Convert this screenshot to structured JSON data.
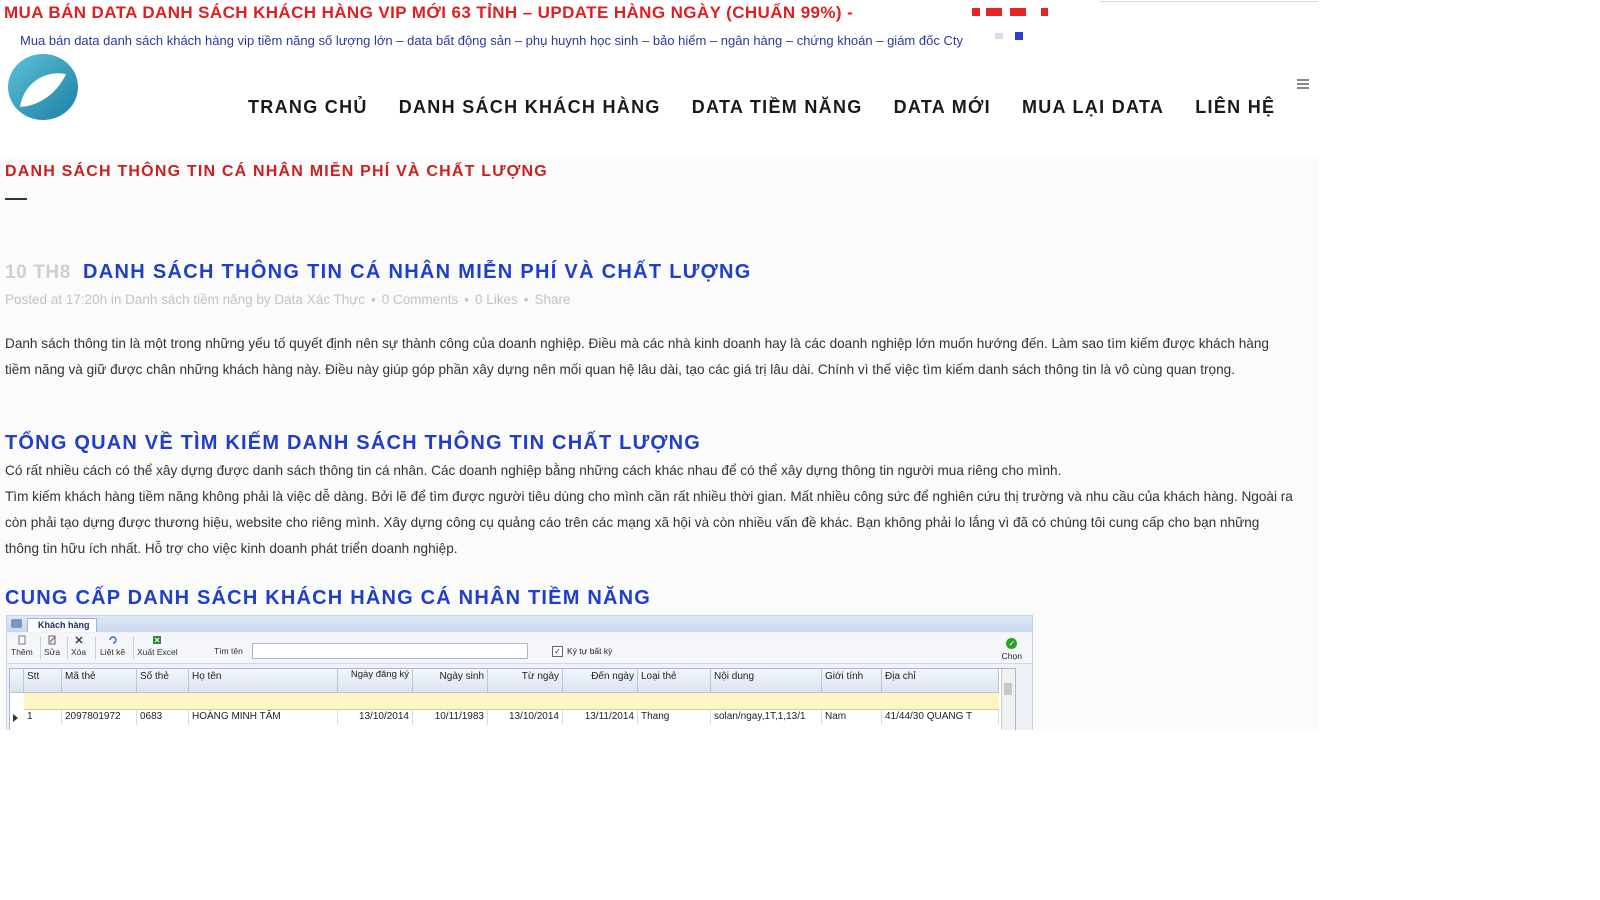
{
  "top_banner": {
    "title": "MUA BÁN DATA DANH SÁCH KHÁCH HÀNG VIP MỚI 63 TỈNH – UPDATE HÀNG NGÀY (CHUẨN 99%) -",
    "tagline": "Mua bán data danh sách khách hàng vip tiềm năng số lượng lớn – data bất động sản – phụ huynh học sinh – bảo hiểm – ngân hàng – chứng khoán – giám đốc Cty",
    "accent_color": "#e02020"
  },
  "header": {
    "logo_icon": "circle-swirl-logo",
    "nav": [
      "TRANG CHỦ",
      "DANH SÁCH KHÁCH HÀNG",
      "DATA TIỀM NĂNG",
      "DATA MỚI",
      "MUA LẠI DATA",
      "LIÊN HỆ"
    ],
    "menu_icon": "hamburger-icon"
  },
  "page_title": "DANH SÁCH THÔNG TIN CÁ NHÂN MIỄN PHÍ VÀ CHẤT LƯỢNG",
  "post": {
    "date": "10 TH8",
    "title": "DANH SÁCH THÔNG TIN CÁ NHÂN MIỄN PHÍ VÀ CHẤT LƯỢNG",
    "meta": {
      "posted": "Posted at 17:20h in Danh sách tiềm năng by Data Xác Thực",
      "comments": "0 Comments",
      "likes": "0 Likes",
      "share": "Share"
    },
    "intro": "Danh sách thông tin là một trong những yếu tố quyết định nên sự thành công của doanh nghiệp. Điều mà các nhà kinh doanh hay là các doanh nghiệp lớn muốn hướng đến. Làm sao tìm kiếm được khách hàng tiềm năng và giữ được chân những khách hàng này. Điều này giúp góp phần xây dựng nên mối quan hệ lâu dài, tạo các giá trị lâu dài. Chính vì thế việc tìm kiếm danh sách thông tin là vô cùng quan trọng.",
    "heading1": "TỔNG QUAN VỀ TÌM KIẾM DANH SÁCH THÔNG TIN CHẤT LƯỢNG",
    "section1_lines": [
      "Có rất nhiều cách có thể xây dựng được danh sách thông tin cá nhân. Các doanh nghiệp bằng những cách khác nhau để có thể xây dựng thông tin người mua riêng cho mình.",
      "Tìm kiếm khách hàng tiềm năng không phải là việc dễ dàng. Bởi lẽ để tìm được người tiêu dùng cho mình cần rất nhiều thời gian. Mất nhiều công sức để nghiên cứu thị trường và nhu cầu của khách hàng. Ngoài ra còn phải tạo dựng được thương hiệu, website cho riêng mình. Xây dựng công cụ quảng cáo trên các mạng xã hội và còn nhiều vấn đề khác. Bạn không phải lo lắng vì đã có chúng tôi cung cấp cho bạn những thông tin hữu ích nhất. Hỗ trợ cho việc kinh doanh phát triển doanh nghiệp."
    ],
    "heading2": "CUNG CẤP DANH SÁCH KHÁCH HÀNG CÁ NHÂN TIỀM NĂNG"
  },
  "software_screenshot": {
    "tab": "Khách hàng",
    "toolbar": [
      "Thêm",
      "Sửa",
      "Xóa",
      "Liệt kê",
      "Xuất Excel"
    ],
    "search_label": "Tìm tên",
    "checkbox_label": "Ký tự bất kỳ",
    "choose_label": "Chọn",
    "columns": [
      "Stt",
      "Mã thẻ",
      "Số thẻ",
      "Họ tên",
      "Ngày đăng ký",
      "Ngày sinh",
      "Từ ngày",
      "Đến ngày",
      "Loại thẻ",
      "Nội dung",
      "Giới tính",
      "Địa chỉ"
    ],
    "rows": [
      [
        "1",
        "2097801972",
        "0683",
        "HOÀNG MINH TÂM",
        "13/10/2014",
        "10/11/1983",
        "13/10/2014",
        "13/11/2014",
        "Thang",
        "solan/ngay,1T,1,13/1",
        "Nam",
        "41/44/30 QUANG T"
      ]
    ]
  }
}
